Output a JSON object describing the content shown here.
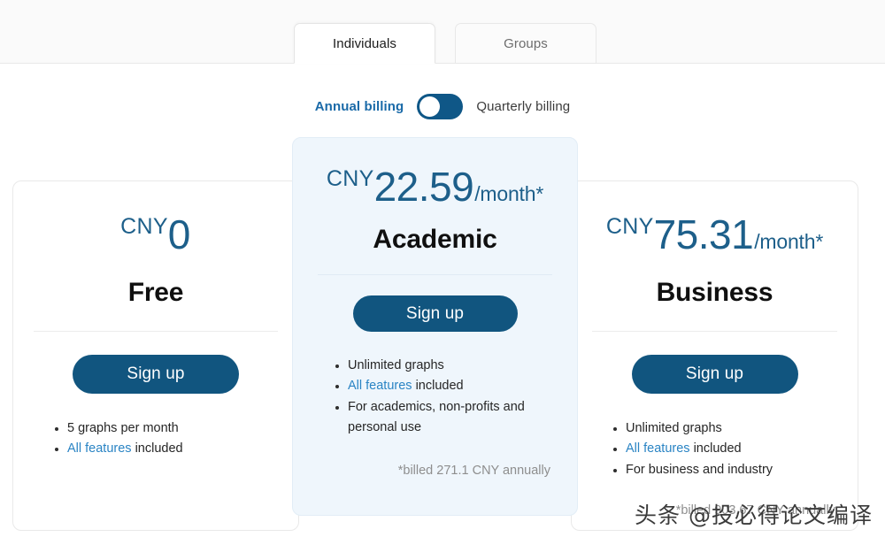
{
  "tabs": [
    {
      "label": "Individuals",
      "active": true
    },
    {
      "label": "Groups",
      "active": false
    }
  ],
  "billing": {
    "annual_label": "Annual billing",
    "quarterly_label": "Quarterly billing",
    "selected": "Annual billing",
    "toggle_position": "left",
    "accent_color": "#0f5787",
    "active_label_color": "#1a6aa8"
  },
  "plans": [
    {
      "id": "free",
      "currency": "CNY",
      "amount": "0",
      "per": "",
      "name": "Free",
      "signup_label": "Sign up",
      "features": [
        {
          "text": "5 graphs per month",
          "link": ""
        },
        {
          "text": " included",
          "link": "All features"
        }
      ],
      "billed_note": ""
    },
    {
      "id": "academic",
      "currency": "CNY",
      "amount": "22.59",
      "per": "/month*",
      "name": "Academic",
      "signup_label": "Sign up",
      "features": [
        {
          "text": "Unlimited graphs",
          "link": ""
        },
        {
          "text": " included",
          "link": "All features"
        },
        {
          "text": "For academics, non-profits and personal use",
          "link": ""
        }
      ],
      "billed_note": "*billed 271.1 CNY annually"
    },
    {
      "id": "business",
      "currency": "CNY",
      "amount": "75.31",
      "per": "/month*",
      "name": "Business",
      "signup_label": "Sign up",
      "features": [
        {
          "text": "Unlimited graphs",
          "link": ""
        },
        {
          "text": " included",
          "link": "All features"
        },
        {
          "text": "For business and industry",
          "link": ""
        }
      ],
      "billed_note": "*billed 903.67 CNY annually"
    }
  ],
  "watermark": {
    "text": "头条 @投必得论文编译"
  }
}
